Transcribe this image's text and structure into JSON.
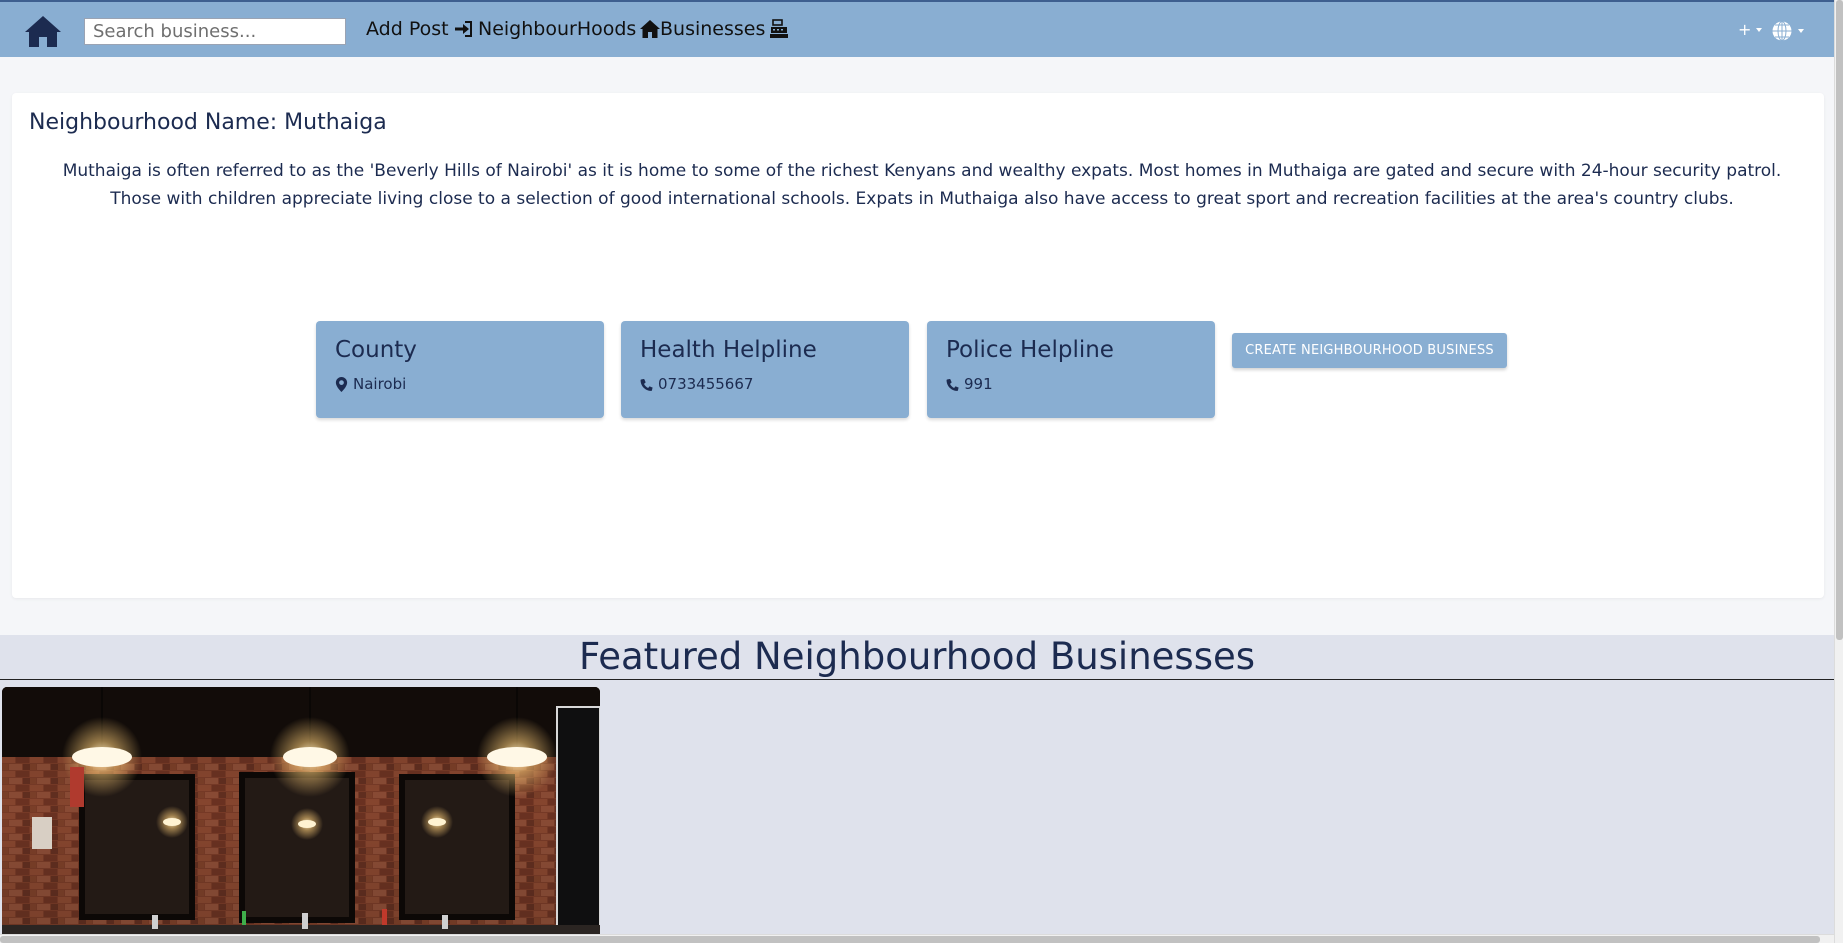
{
  "navbar": {
    "search_placeholder": "Search business...",
    "links": {
      "add_post": "Add Post",
      "neighbourhoods": "NeighbourHoods",
      "businesses": "Businesses"
    },
    "right": {
      "plus_label": "+",
      "globe_icon": "globe-icon"
    },
    "colors": {
      "bar": "#89aed2",
      "brand": "#1c2b50"
    }
  },
  "neighbourhood": {
    "title": "Neighbourhood Name: Muthaiga",
    "description": "Muthaiga is often referred to as the 'Beverly Hills of Nairobi' as it is home to some of the richest Kenyans and wealthy expats. Most homes in Muthaiga are gated and secure with 24-hour security patrol. Those with children appreciate living close to a selection of good international schools. Expats in Muthaiga also have access to great sport and recreation facilities at the area's country clubs.",
    "cards": [
      {
        "title": "County",
        "value": "Nairobi",
        "icon": "map-marker-icon"
      },
      {
        "title": "Health Helpline",
        "value": "0733455667",
        "icon": "phone-icon"
      },
      {
        "title": "Police Helpline",
        "value": "991",
        "icon": "phone-icon"
      }
    ],
    "create_button": "CREATE NEIGHBOURHOOD BUSINESS"
  },
  "featured": {
    "title": "Featured Neighbourhood Businesses"
  }
}
